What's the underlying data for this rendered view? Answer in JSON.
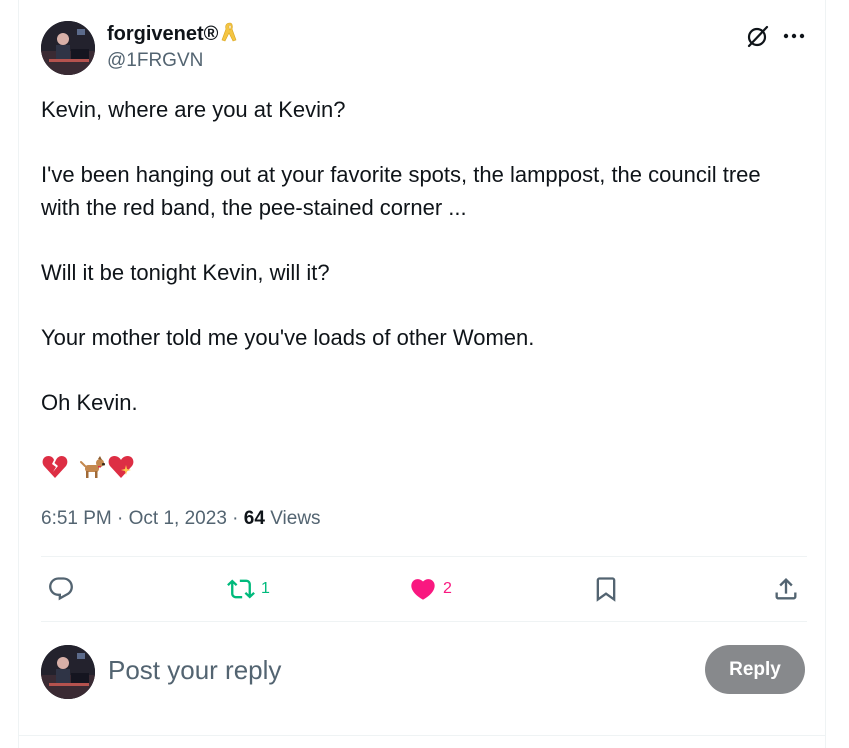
{
  "author": {
    "display_name": "forgivenet®",
    "handle": "@1FRGVN"
  },
  "tweet": {
    "paragraphs": [
      "Kevin, where are you at Kevin?",
      "I've been hanging out at your favorite spots, the lamppost, the council tree with the red band, the pee-stained corner ...",
      "Will it be tonight Kevin, will it?",
      "Your mother told me you've loads of other Women.",
      "Oh Kevin."
    ],
    "emojis": [
      "broken-heart-emoji",
      "dog-emoji",
      "sparkling-heart-emoji"
    ]
  },
  "meta": {
    "time": "6:51 PM",
    "separator": " · ",
    "date": "Oct 1, 2023",
    "views_count": "64",
    "views_label": " Views"
  },
  "actions": {
    "reply_count": "",
    "retweet_count": "1",
    "like_count": "2",
    "colors": {
      "retweet": "#00ba7c",
      "like": "#f91880",
      "default": "#536471"
    }
  },
  "composer": {
    "placeholder": "Post your reply",
    "reply_button": "Reply"
  },
  "icons": {
    "header": [
      "grok-icon",
      "more-icon"
    ],
    "actions": [
      "reply-icon",
      "retweet-icon",
      "like-icon",
      "bookmark-icon",
      "share-icon"
    ]
  }
}
